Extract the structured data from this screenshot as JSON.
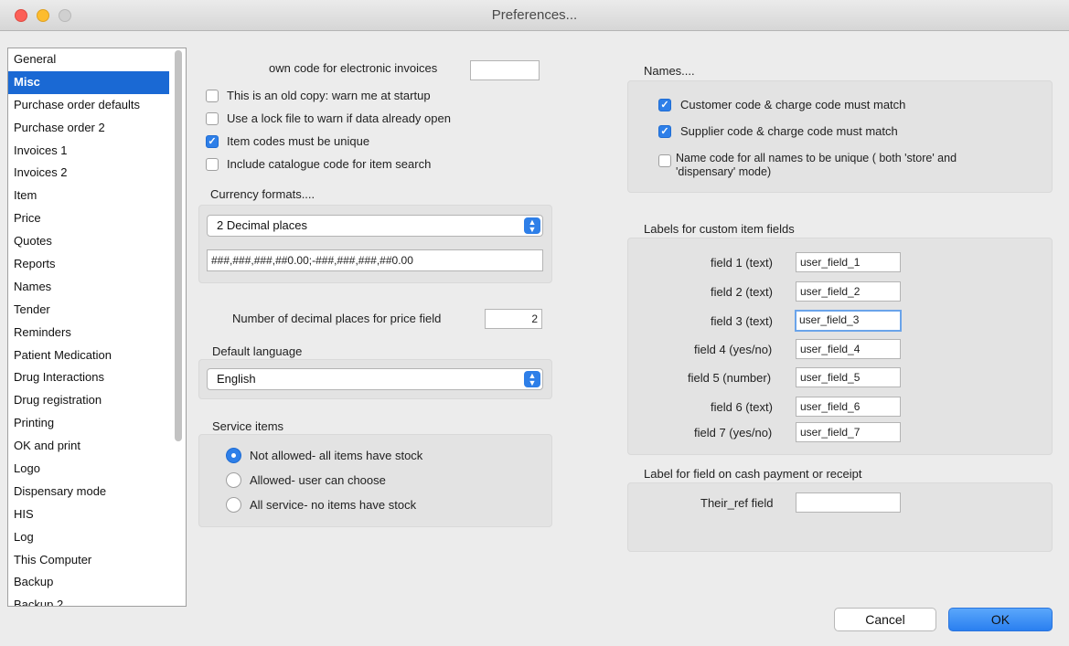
{
  "window": {
    "title": "Preferences..."
  },
  "sidebar": {
    "items": [
      "General",
      "Misc",
      "Purchase order defaults",
      "Purchase order 2",
      "Invoices 1",
      "Invoices 2",
      "Item",
      "Price",
      "Quotes",
      "Reports",
      "Names",
      "Tender",
      "Reminders",
      "Patient Medication",
      "Drug Interactions",
      "Drug registration",
      "Printing",
      "OK and print",
      "Logo",
      "Dispensary mode",
      "HIS",
      "Log",
      "This Computer",
      "Backup",
      "Backup 2"
    ],
    "selected": "Misc"
  },
  "misc": {
    "own_code_label": "own code for electronic invoices",
    "own_code_value": "",
    "checkboxes": [
      {
        "label": "This is an old copy: warn me at startup",
        "checked": false
      },
      {
        "label": "Use a lock file to warn if data already open",
        "checked": false
      },
      {
        "label": "Item codes must be unique",
        "checked": true
      },
      {
        "label": "Include catalogue code for item search",
        "checked": false
      }
    ]
  },
  "currency": {
    "heading": "Currency formats....",
    "selected_format": "2 Decimal places",
    "format_string": "###,###,###,##0.00;-###,###,###,##0.00"
  },
  "decimals": {
    "label": "Number of decimal places for price field",
    "value": "2"
  },
  "language": {
    "heading": "Default language",
    "selected": "English"
  },
  "service_items": {
    "heading": "Service items",
    "options": [
      {
        "label": "Not allowed- all items have stock",
        "selected": true
      },
      {
        "label": "Allowed- user can choose",
        "selected": false
      },
      {
        "label": "All service- no items have stock",
        "selected": false
      }
    ]
  },
  "names": {
    "heading": "Names....",
    "checkboxes": [
      {
        "label": "Customer code & charge code must match",
        "checked": true
      },
      {
        "label": "Supplier code & charge code must match",
        "checked": true
      },
      {
        "label": "Name code for all names to be unique ( both 'store' and",
        "label_line2": "'dispensary' mode)",
        "checked": false
      }
    ]
  },
  "custom_fields": {
    "heading": "Labels for custom item fields",
    "fields": [
      {
        "label": "field 1 (text)",
        "value": "user_field_1"
      },
      {
        "label": "field 2 (text)",
        "value": "user_field_2"
      },
      {
        "label": "field 3 (text)",
        "value": "user_field_3"
      },
      {
        "label": "field 4 (yes/no)",
        "value": "user_field_4"
      },
      {
        "label": "field 5 (number)",
        "value": "user_field_5"
      },
      {
        "label": "field 6 (text)",
        "value": "user_field_6"
      },
      {
        "label": "field 7 (yes/no)",
        "value": "user_field_7"
      }
    ],
    "focused_field": 3
  },
  "cash_payment": {
    "heading": "Label for field on cash payment or receipt",
    "their_ref_label": "Their_ref field",
    "their_ref_value": ""
  },
  "buttons": {
    "cancel": "Cancel",
    "ok": "OK"
  },
  "colors": {
    "accent": "#2e7fe8",
    "selection": "#1a69d4"
  }
}
